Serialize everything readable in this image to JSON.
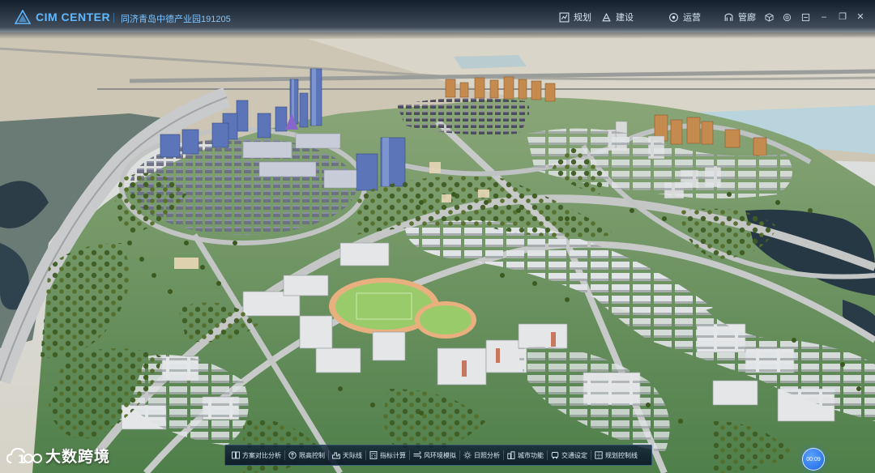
{
  "header": {
    "app_title": "CIM CENTER",
    "project_title": "同济青岛中德产业园191205",
    "nav": [
      {
        "label": "规划",
        "icon": "planning-icon"
      },
      {
        "label": "建设",
        "icon": "construction-icon"
      },
      {
        "label": "运营",
        "icon": "operation-icon"
      },
      {
        "label": "管廊",
        "icon": "pipe-gallery-icon"
      }
    ],
    "tools": [
      "cube-icon",
      "gear-icon",
      "layers-icon"
    ],
    "window": {
      "minimize": "–",
      "restore": "❐",
      "close": "✕"
    }
  },
  "brand": {
    "text": "大数跨境",
    "logo": "cloud-100-logo"
  },
  "toolbar": {
    "items": [
      {
        "label": "方案对比分析",
        "icon": "compare-icon"
      },
      {
        "label": "限高控制",
        "icon": "height-limit-icon"
      },
      {
        "label": "天际线",
        "icon": "skyline-icon"
      },
      {
        "label": "指标计算",
        "icon": "calculator-icon"
      },
      {
        "label": "风环境模拟",
        "icon": "wind-icon"
      },
      {
        "label": "日照分析",
        "icon": "sun-icon"
      },
      {
        "label": "城市功能",
        "icon": "city-icon"
      },
      {
        "label": "交通设定",
        "icon": "traffic-icon"
      },
      {
        "label": "规划控制线",
        "icon": "control-line-icon"
      }
    ]
  },
  "timer": {
    "value": "00:09"
  },
  "colors": {
    "accent": "#5fb8ff",
    "grass": "#6f9a62",
    "road": "#b8bcbc",
    "water": "#2a3e4c",
    "desert": "#cbc3b0",
    "timer": "#2a74f0"
  }
}
